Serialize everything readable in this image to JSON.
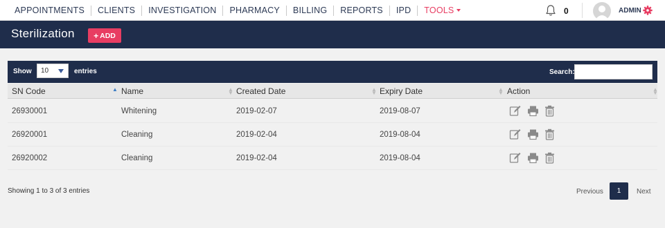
{
  "nav": {
    "items": [
      {
        "label": "APPOINTMENTS"
      },
      {
        "label": "CLIENTS"
      },
      {
        "label": "INVESTIGATION"
      },
      {
        "label": "PHARMACY"
      },
      {
        "label": "BILLING"
      },
      {
        "label": "REPORTS"
      },
      {
        "label": "IPD"
      },
      {
        "label": "TOOLS"
      }
    ],
    "active_item": "TOOLS",
    "notification_count": "0",
    "user_label": "ADMIN",
    "accent_color": "#e83d62",
    "icons": [
      "bell-icon",
      "avatar",
      "gear-icon"
    ]
  },
  "header": {
    "title": "Sterilization",
    "add_label": "ADD"
  },
  "toolbar": {
    "show_label": "Show",
    "page_length": "10",
    "entries_label": "entries",
    "search_label": "Search:",
    "search_value": ""
  },
  "table": {
    "columns": [
      "SN Code",
      "Name",
      "Created Date",
      "Expiry Date",
      "Action"
    ],
    "sorted_column": "SN Code",
    "sort_direction": "ascending",
    "rows": [
      {
        "sn_code": "26930001",
        "name": "Whitening",
        "created": "2019-02-07",
        "expiry": "2019-08-07"
      },
      {
        "sn_code": "26920001",
        "name": "Cleaning",
        "created": "2019-02-04",
        "expiry": "2019-08-04"
      },
      {
        "sn_code": "26920002",
        "name": "Cleaning",
        "created": "2019-02-04",
        "expiry": "2019-08-04"
      }
    ],
    "row_actions": [
      "edit-icon",
      "print-icon",
      "trash-icon"
    ]
  },
  "footer": {
    "info": "Showing 1 to 3 of 3 entries",
    "prev_label": "Previous",
    "current_page": "1",
    "next_label": "Next"
  },
  "colors": {
    "navy": "#1f2d4b",
    "accent": "#e83d62",
    "background": "#f1f1f1"
  }
}
